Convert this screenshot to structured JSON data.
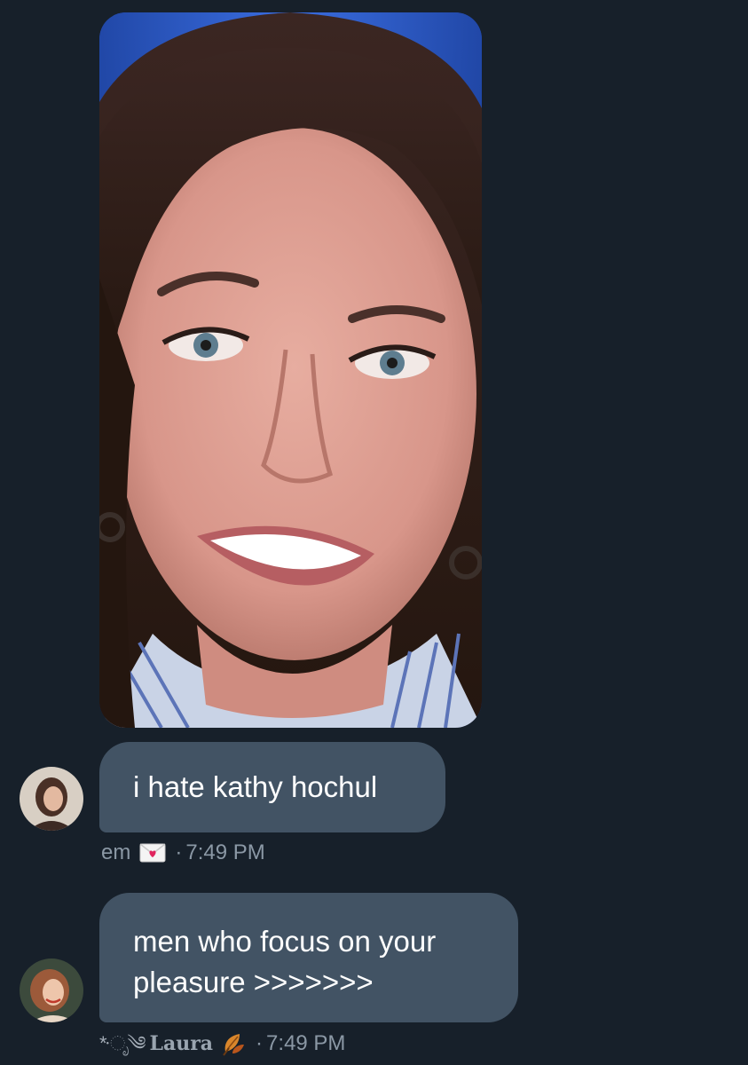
{
  "messages": [
    {
      "type": "image",
      "image_icon": "portrait-photo"
    },
    {
      "type": "text",
      "text": "i hate kathy hochul",
      "sender": {
        "name": "em",
        "badge_icon": "love-letter-icon"
      },
      "separator": "·",
      "time": "7:49 PM"
    },
    {
      "type": "text",
      "text_lines": [
        "men who focus on your",
        "pleasure >>>>>>>"
      ],
      "sender": {
        "prefix_decoration": "*·ೃ༄",
        "name": "Laura",
        "badge_icon": "autumn-leaf-icon"
      },
      "separator": "·",
      "time": "7:49 PM"
    }
  ],
  "colors": {
    "background": "#17202a",
    "bubble": "#425364",
    "meta_text": "#8b98a5",
    "message_text": "#ffffff"
  }
}
